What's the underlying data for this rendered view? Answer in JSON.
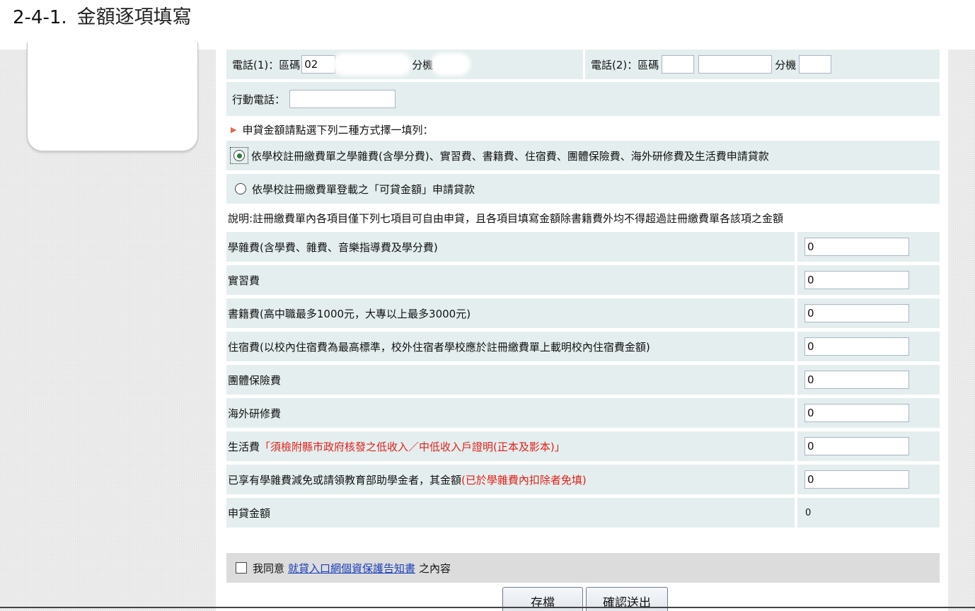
{
  "doc_heading": {
    "number": "2-4-1.",
    "title": "金額逐項填寫"
  },
  "phone1": {
    "label": "電話(1)：區碼",
    "area_code": "02",
    "ext_label": "分機"
  },
  "phone2": {
    "label": "電話(2)：區碼",
    "ext_label": "分機"
  },
  "mobile": {
    "label": "行動電話："
  },
  "instruction": "申貸金額請點選下列二種方式擇一填列：",
  "option1": {
    "label": "依學校註冊繳費單之學雜費(含學分費)、實習費、書籍費、住宿費、團體保險費、海外研修費及生活費申請貸款",
    "selected": true
  },
  "option2": {
    "label": "依學校註冊繳費單登載之「可貸金額」申請貸款",
    "selected": false
  },
  "note": "說明:註冊繳費單內各項目僅下列七項目可自由申貸，且各項目填寫金額除書籍費外均不得超過註冊繳費單各該項之金額",
  "items": [
    {
      "label": "學雜費(含學費、雜費、音樂指導費及學分費)",
      "value": "0"
    },
    {
      "label": "實習費",
      "value": "0"
    },
    {
      "label": "書籍費(高中職最多1000元，大專以上最多3000元)",
      "value": "0"
    },
    {
      "label": "住宿費(以校內住宿費為最高標準，校外住宿者學校應於註冊繳費單上載明校內住宿費金額)",
      "value": "0"
    },
    {
      "label": "團體保險費",
      "value": "0"
    },
    {
      "label": "海外研修費",
      "value": "0"
    },
    {
      "label": "生活費",
      "note": "「須檢附縣市政府核發之低收入／中低收入戶證明(正本及影本)」",
      "value": "0"
    },
    {
      "label": "已享有學雜費減免或請領教育部助學金者，其金額",
      "note": "(已於學雜費內扣除者免填)",
      "value": "0"
    }
  ],
  "loan_total": {
    "label": "申貸金額",
    "value": "0"
  },
  "agree": {
    "prefix": "我同意",
    "link": "就貸入口網個資保護告知書",
    "suffix": "之內容",
    "checked": false
  },
  "buttons": {
    "save": "存檔",
    "submit": "確認送出"
  },
  "colors": {
    "row_bg": "#e4eeee",
    "red_note": "#e0201b",
    "link": "#1a3fb8",
    "radio_dot": "#2a7a3a"
  }
}
